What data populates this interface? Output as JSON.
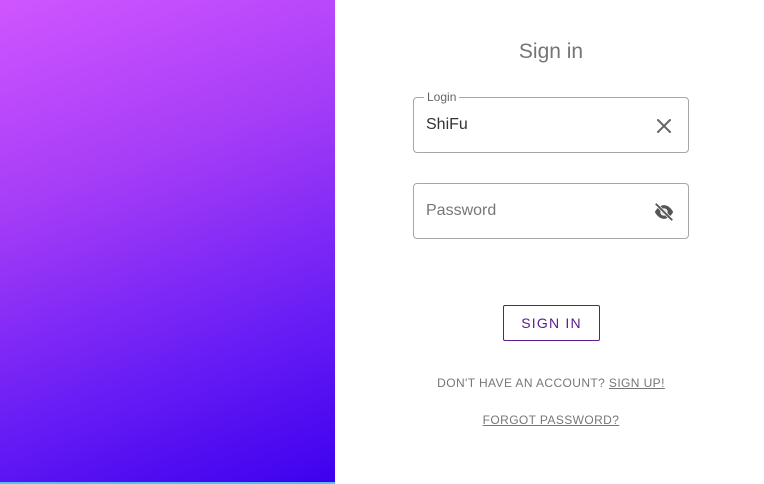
{
  "form": {
    "title": "Sign in",
    "login": {
      "label": "Login",
      "value": "ShiFu",
      "clear_icon": "close-icon"
    },
    "password": {
      "placeholder": "Password",
      "visibility_icon": "eye-off-icon"
    },
    "submit_label": "SIGN IN",
    "signup_prompt": "DON'T HAVE AN ACCOUNT?",
    "signup_link": "SIGN UP!",
    "forgot_link": "FORGOT PASSWORD?"
  },
  "colors": {
    "gradient_start": "#d056ff",
    "gradient_end": "#3d00ee",
    "button_accent": "#5b1b8c"
  }
}
